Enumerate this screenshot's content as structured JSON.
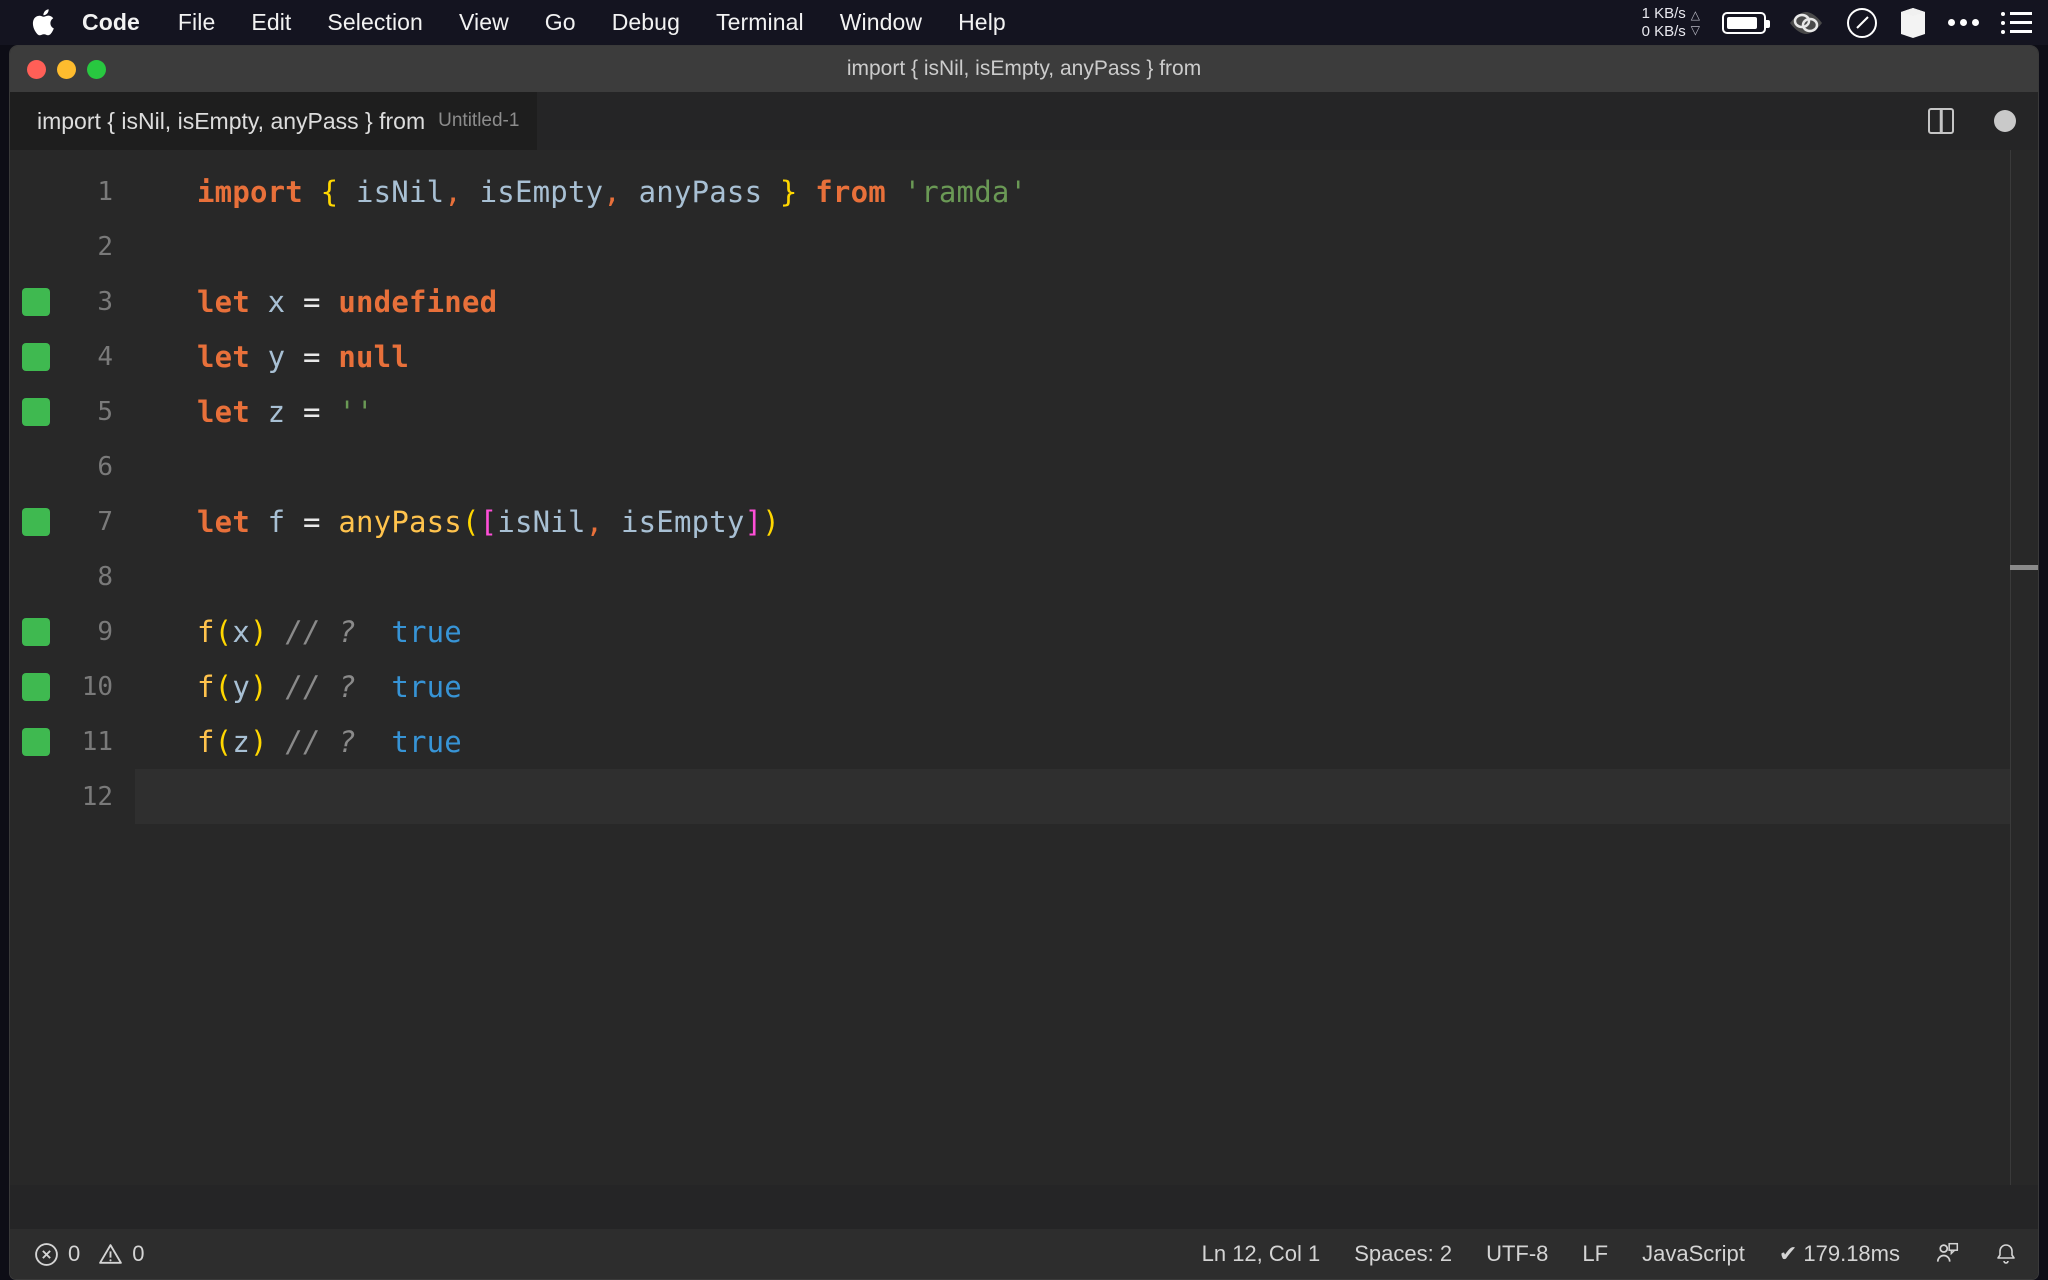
{
  "menubar": {
    "apple_icon": "apple-logo-icon",
    "items": [
      {
        "label": "Code",
        "bold": true
      },
      {
        "label": "File",
        "bold": false
      },
      {
        "label": "Edit",
        "bold": false
      },
      {
        "label": "Selection",
        "bold": false
      },
      {
        "label": "View",
        "bold": false
      },
      {
        "label": "Go",
        "bold": false
      },
      {
        "label": "Debug",
        "bold": false
      },
      {
        "label": "Terminal",
        "bold": false
      },
      {
        "label": "Window",
        "bold": false
      },
      {
        "label": "Help",
        "bold": false
      }
    ],
    "status": {
      "net_up": "1 KB/s",
      "net_down": "0 KB/s",
      "up_arrow": "△",
      "down_arrow": "▽",
      "battery_icon": "battery-icon",
      "eye_icon": "eye-icon",
      "gauge_icon": "gauge-icon",
      "cube_icon": "cube-icon",
      "more_icon": "ellipsis-icon",
      "list_icon": "list-icon"
    }
  },
  "window": {
    "title": "import { isNil, isEmpty, anyPass } from",
    "traffic": {
      "close": "close",
      "minimize": "minimize",
      "maximize": "maximize"
    }
  },
  "tab": {
    "title": "import { isNil, isEmpty, anyPass } from",
    "subtitle": "Untitled-1",
    "split_icon": "split-editor-icon",
    "dirty_indicator": "unsaved-dot-icon"
  },
  "editor": {
    "lines": [
      {
        "num": "1",
        "marker": false,
        "current": false,
        "tokens": [
          {
            "t": "import",
            "c": "kw"
          },
          {
            "t": " ",
            "c": "op"
          },
          {
            "t": "{",
            "c": "br-y"
          },
          {
            "t": " ",
            "c": "op"
          },
          {
            "t": "isNil",
            "c": "var"
          },
          {
            "t": ",",
            "c": "punct-o"
          },
          {
            "t": " ",
            "c": "op"
          },
          {
            "t": "isEmpty",
            "c": "var"
          },
          {
            "t": ",",
            "c": "punct-o"
          },
          {
            "t": " ",
            "c": "op"
          },
          {
            "t": "anyPass",
            "c": "var"
          },
          {
            "t": " ",
            "c": "op"
          },
          {
            "t": "}",
            "c": "br-y"
          },
          {
            "t": " ",
            "c": "op"
          },
          {
            "t": "from",
            "c": "kw"
          },
          {
            "t": " ",
            "c": "op"
          },
          {
            "t": "'ramda'",
            "c": "str"
          }
        ]
      },
      {
        "num": "2",
        "marker": false,
        "current": false,
        "tokens": []
      },
      {
        "num": "3",
        "marker": true,
        "current": false,
        "tokens": [
          {
            "t": "let",
            "c": "kw"
          },
          {
            "t": " ",
            "c": "op"
          },
          {
            "t": "x",
            "c": "var"
          },
          {
            "t": " ",
            "c": "op"
          },
          {
            "t": "=",
            "c": "op"
          },
          {
            "t": " ",
            "c": "op"
          },
          {
            "t": "undefined",
            "c": "kw"
          }
        ]
      },
      {
        "num": "4",
        "marker": true,
        "current": false,
        "tokens": [
          {
            "t": "let",
            "c": "kw"
          },
          {
            "t": " ",
            "c": "op"
          },
          {
            "t": "y",
            "c": "var"
          },
          {
            "t": " ",
            "c": "op"
          },
          {
            "t": "=",
            "c": "op"
          },
          {
            "t": " ",
            "c": "op"
          },
          {
            "t": "null",
            "c": "kw"
          }
        ]
      },
      {
        "num": "5",
        "marker": true,
        "current": false,
        "tokens": [
          {
            "t": "let",
            "c": "kw"
          },
          {
            "t": " ",
            "c": "op"
          },
          {
            "t": "z",
            "c": "var"
          },
          {
            "t": " ",
            "c": "op"
          },
          {
            "t": "=",
            "c": "op"
          },
          {
            "t": " ",
            "c": "op"
          },
          {
            "t": "''",
            "c": "str"
          }
        ]
      },
      {
        "num": "6",
        "marker": false,
        "current": false,
        "tokens": []
      },
      {
        "num": "7",
        "marker": true,
        "current": false,
        "tokens": [
          {
            "t": "let",
            "c": "kw"
          },
          {
            "t": " ",
            "c": "op"
          },
          {
            "t": "f",
            "c": "var"
          },
          {
            "t": " ",
            "c": "op"
          },
          {
            "t": "=",
            "c": "op"
          },
          {
            "t": " ",
            "c": "op"
          },
          {
            "t": "anyPass",
            "c": "fn"
          },
          {
            "t": "(",
            "c": "br-y"
          },
          {
            "t": "[",
            "c": "br-m"
          },
          {
            "t": "isNil",
            "c": "var"
          },
          {
            "t": ",",
            "c": "punct-o"
          },
          {
            "t": " ",
            "c": "op"
          },
          {
            "t": "isEmpty",
            "c": "var"
          },
          {
            "t": "]",
            "c": "br-m"
          },
          {
            "t": ")",
            "c": "br-y"
          }
        ]
      },
      {
        "num": "8",
        "marker": false,
        "current": false,
        "tokens": []
      },
      {
        "num": "9",
        "marker": true,
        "current": false,
        "tokens": [
          {
            "t": "f",
            "c": "fn"
          },
          {
            "t": "(",
            "c": "br-y"
          },
          {
            "t": "x",
            "c": "var"
          },
          {
            "t": ")",
            "c": "br-y"
          },
          {
            "t": " ",
            "c": "op"
          },
          {
            "t": "// ?",
            "c": "cmt"
          },
          {
            "t": "  ",
            "c": "op"
          },
          {
            "t": "true",
            "c": "bool"
          }
        ]
      },
      {
        "num": "10",
        "marker": true,
        "current": false,
        "tokens": [
          {
            "t": "f",
            "c": "fn"
          },
          {
            "t": "(",
            "c": "br-y"
          },
          {
            "t": "y",
            "c": "var"
          },
          {
            "t": ")",
            "c": "br-y"
          },
          {
            "t": " ",
            "c": "op"
          },
          {
            "t": "// ?",
            "c": "cmt"
          },
          {
            "t": "  ",
            "c": "op"
          },
          {
            "t": "true",
            "c": "bool"
          }
        ]
      },
      {
        "num": "11",
        "marker": true,
        "current": false,
        "tokens": [
          {
            "t": "f",
            "c": "fn"
          },
          {
            "t": "(",
            "c": "br-y"
          },
          {
            "t": "z",
            "c": "var"
          },
          {
            "t": ")",
            "c": "br-y"
          },
          {
            "t": " ",
            "c": "op"
          },
          {
            "t": "// ?",
            "c": "cmt"
          },
          {
            "t": "  ",
            "c": "op"
          },
          {
            "t": "true",
            "c": "bool"
          }
        ]
      },
      {
        "num": "12",
        "marker": false,
        "current": true,
        "tokens": []
      }
    ]
  },
  "statusbar": {
    "errors": "0",
    "warnings": "0",
    "position": "Ln 12, Col 1",
    "indentation": "Spaces: 2",
    "encoding": "UTF-8",
    "eol": "LF",
    "language": "JavaScript",
    "runtime": "✔ 179.18ms",
    "feedback_icon": "feedback-icon",
    "bell_icon": "bell-icon"
  },
  "colors": {
    "gutter_marker": "#3fb950",
    "keyword": "#e8703a",
    "function": "#ffc34d",
    "string": "#6a9955",
    "boolean": "#3794d6",
    "bracket_yellow": "#ffd700",
    "bracket_magenta": "#ff4fd8",
    "editor_bg": "#282828",
    "statusbar_bg": "#2d2d2d"
  }
}
